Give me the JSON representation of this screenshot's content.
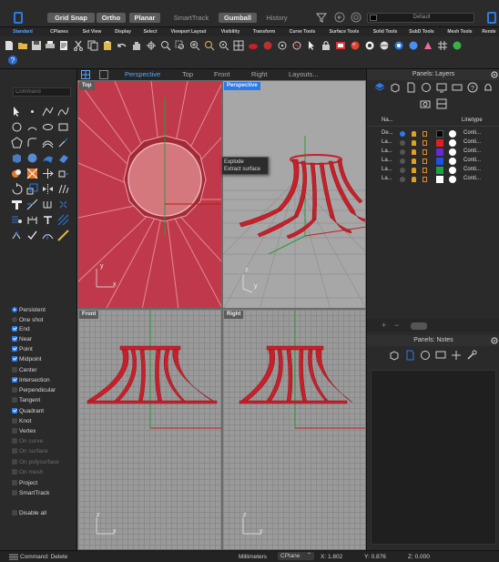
{
  "topbar": {
    "grid_snap": "Grid Snap",
    "ortho": "Ortho",
    "planar": "Planar",
    "smarttrack": "SmartTrack",
    "gumball": "Gumball",
    "history": "History",
    "layer_dropdown": "Default"
  },
  "tabs": [
    "Standard",
    "CPlanes",
    "Set View",
    "Display",
    "Select",
    "Viewport Layout",
    "Visibility",
    "Transform",
    "Curve Tools",
    "Surface Tools",
    "Solid Tools",
    "SubD Tools",
    "Mesh Tools",
    "Rende"
  ],
  "selected_tab_index": 0,
  "command": {
    "placeholder": "Command"
  },
  "viewport_tabs": [
    "Perspective",
    "Top",
    "Front",
    "Right",
    "Layouts..."
  ],
  "viewports": {
    "top": "Top",
    "perspective": "Perspective",
    "front": "Front",
    "right": "Right"
  },
  "axis_labels": {
    "y": "y",
    "x": "x",
    "z": "z"
  },
  "context_menu": {
    "items": [
      "Explode",
      "Extract surface"
    ]
  },
  "osnap": {
    "mode": [
      {
        "label": "Persistent",
        "selected": true
      },
      {
        "label": "One shot",
        "selected": false
      }
    ],
    "items": [
      {
        "label": "End",
        "checked": true,
        "enabled": true
      },
      {
        "label": "Near",
        "checked": true,
        "enabled": true
      },
      {
        "label": "Point",
        "checked": true,
        "enabled": true
      },
      {
        "label": "Midpoint",
        "checked": true,
        "enabled": true
      },
      {
        "label": "Center",
        "checked": false,
        "enabled": true
      },
      {
        "label": "Intersection",
        "checked": true,
        "enabled": true
      },
      {
        "label": "Perpendicular",
        "checked": false,
        "enabled": true
      },
      {
        "label": "Tangent",
        "checked": false,
        "enabled": true
      },
      {
        "label": "Quadrant",
        "checked": true,
        "enabled": true
      },
      {
        "label": "Knot",
        "checked": false,
        "enabled": true
      },
      {
        "label": "Vertex",
        "checked": false,
        "enabled": true
      },
      {
        "label": "On curve",
        "checked": false,
        "enabled": false
      },
      {
        "label": "On surface",
        "checked": false,
        "enabled": false
      },
      {
        "label": "On polysurface",
        "checked": false,
        "enabled": false
      },
      {
        "label": "On mesh",
        "checked": false,
        "enabled": false
      },
      {
        "label": "Project",
        "checked": false,
        "enabled": true
      },
      {
        "label": "SmartTrack",
        "checked": false,
        "enabled": true
      }
    ],
    "disable_all": "Disable all"
  },
  "layers_panel": {
    "title": "Panels: Layers",
    "col_name": "Na...",
    "col_linetype": "Linetype",
    "rows": [
      {
        "name": "De...",
        "color": "#000000",
        "current": true,
        "linetype": "Conti..."
      },
      {
        "name": "La...",
        "color": "#e02020",
        "current": false,
        "linetype": "Conti..."
      },
      {
        "name": "La...",
        "color": "#6a2ad0",
        "current": false,
        "linetype": "Conti..."
      },
      {
        "name": "La...",
        "color": "#2050e0",
        "current": false,
        "linetype": "Conti..."
      },
      {
        "name": "La...",
        "color": "#20a040",
        "current": false,
        "linetype": "Conti..."
      },
      {
        "name": "La...",
        "color": "#ffffff",
        "current": false,
        "linetype": "Conti..."
      }
    ]
  },
  "notes_panel": {
    "title": "Panels: Notes"
  },
  "statusbar": {
    "command": "Command: Delete",
    "units": "Millimeters",
    "cplane": "CPlane",
    "x": "X: 1.802",
    "y": "Y: 0.876",
    "z": "Z: 0.000"
  },
  "colors": {
    "accent": "#2a7bea",
    "object_red": "#c8202a",
    "grid": "#9a9a9a"
  }
}
